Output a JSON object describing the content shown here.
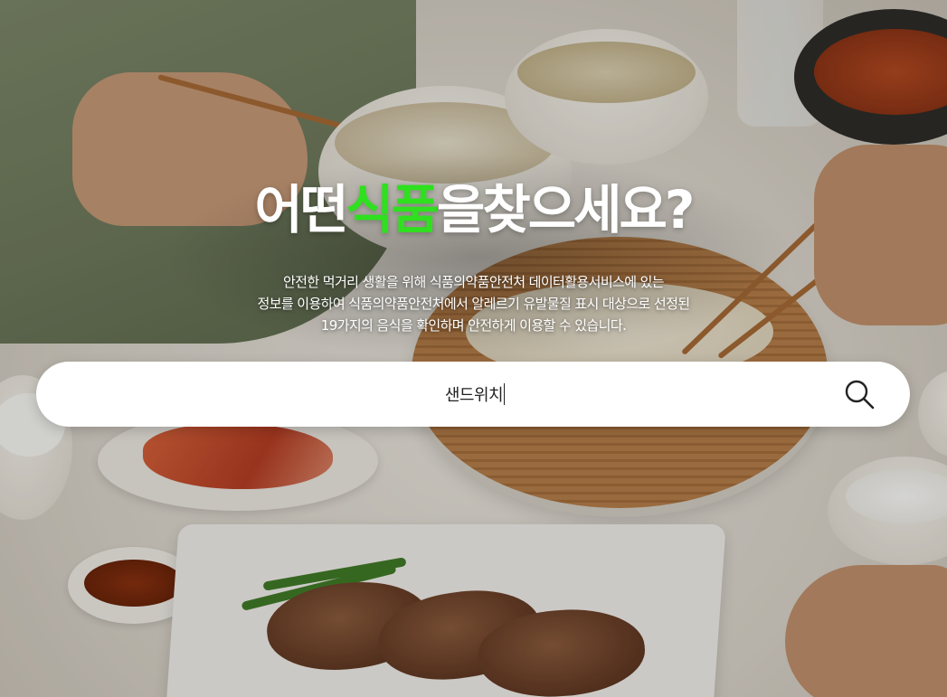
{
  "headline": {
    "part1": "어떤",
    "accent": "식품",
    "part2": "을찾으세요?"
  },
  "description": {
    "line1": "안전한 먹거리 생활을 위해 식품의약품안전처 데이터활용서비스에 있는",
    "line2": "정보를 이용하여 식품의약품안전처에서 알레르기 유발물질 표시 대상으로 선정된",
    "line3": "19가지의 음식을 확인하며 안전하게 이용할 수 있습니다."
  },
  "search": {
    "value": "샌드위치",
    "icon": "search-icon"
  },
  "colors": {
    "accent": "#2fe01e",
    "text": "#ffffff",
    "search_bg": "#ffffff"
  }
}
